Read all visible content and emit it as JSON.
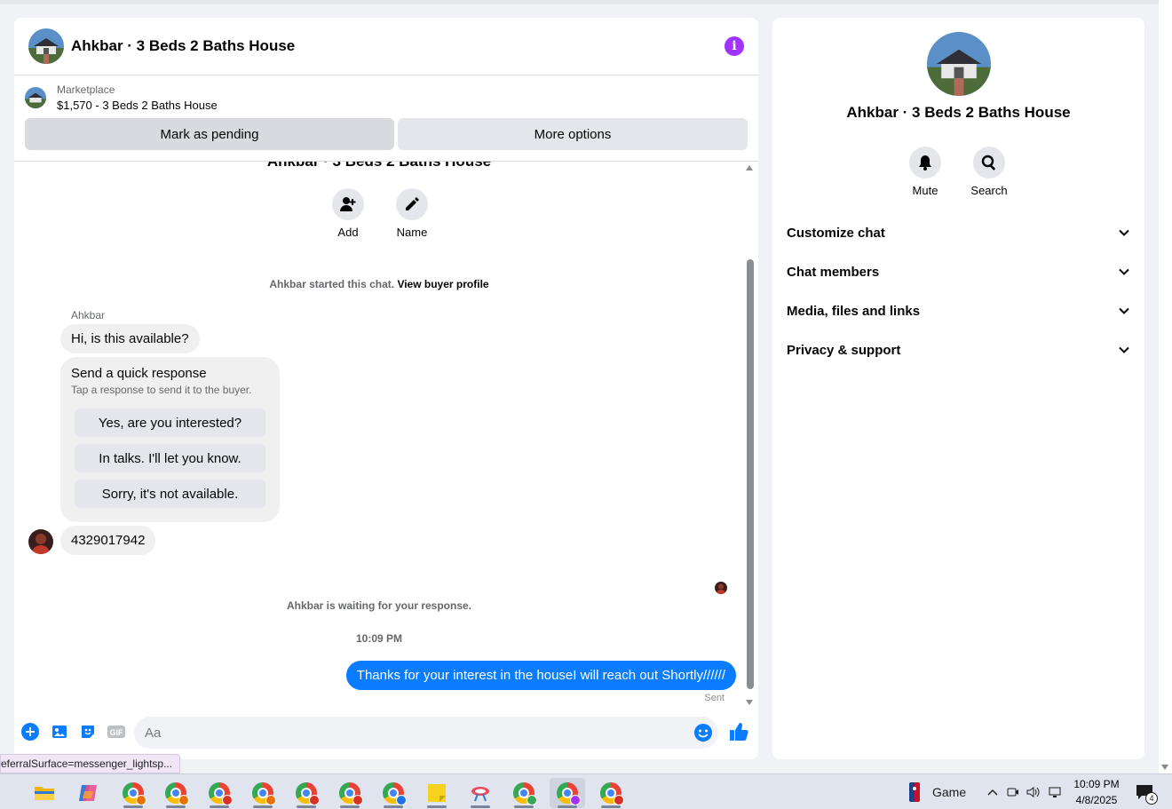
{
  "chat": {
    "title": "Ahkbar · 3 Beds 2 Baths House",
    "marketplace_label": "Marketplace",
    "listing": "$1,570 - 3 Beds 2 Baths House",
    "mark_pending": "Mark as pending",
    "more_options": "More options",
    "thread_name": "Ahkbar · 3 Beds 2 Baths House",
    "add_label": "Add",
    "name_label": "Name",
    "started_text": "Ahkbar started this chat.",
    "view_buyer_profile": "View buyer profile",
    "sender": "Ahkbar",
    "first_message": "Hi, is this available?",
    "quick_title": "Send a quick response",
    "quick_sub": "Tap a response to send it to the buyer.",
    "quick_responses": [
      "Yes, are you interested?",
      "In talks. I'll let you know.",
      "Sorry, it's not available."
    ],
    "phone_message": "4329017942",
    "waiting_text": "Ahkbar is waiting for your response.",
    "timestamp": "10:09 PM",
    "sent_message": "Thanks for your interest in the houseI will reach out Shortly//////",
    "sent_status": "Sent",
    "composer_placeholder": "Aa",
    "gif_label": "GIF"
  },
  "tooltip": {
    "url": "eferralSurface=messenger_lightsp..."
  },
  "info": {
    "title": "Ahkbar · 3 Beds 2 Baths House",
    "mute": "Mute",
    "search": "Search",
    "sections": [
      "Customize chat",
      "Chat members",
      "Media, files and links",
      "Privacy & support"
    ]
  },
  "taskbar": {
    "weather": "Game",
    "time": "10:09 PM",
    "date": "4/8/2025",
    "notifications": "4"
  },
  "colors": {
    "accent": "#0a7cff",
    "info": "#a033ff"
  }
}
